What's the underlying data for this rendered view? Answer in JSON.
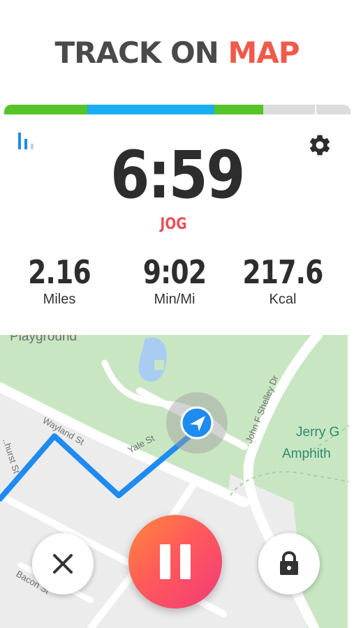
{
  "headline": {
    "part1": "TRACK ON",
    "part2": "MAP"
  },
  "colors": {
    "accent_red": "#f05a4a",
    "mode_red": "#e8505b",
    "route_blue": "#1e8bf0",
    "seg_green": "#55c428",
    "seg_blue": "#18aef0",
    "seg_gray": "#dcdcdc"
  },
  "progress_segments": [
    {
      "color": "#55c428",
      "fraction": 0.24
    },
    {
      "color": "#18aef0",
      "fraction": 0.37
    },
    {
      "color": "#55c428",
      "fraction": 0.14
    },
    {
      "color": "#dcdcdc",
      "fraction": 0.15
    },
    {
      "color": "#dcdcdc",
      "fraction": 0.1
    }
  ],
  "workout": {
    "timer": "6:59",
    "mode": "JOG",
    "stats": [
      {
        "value": "2.16",
        "unit": "Miles"
      },
      {
        "value": "9:02",
        "unit": "Min/Mi"
      },
      {
        "value": "217.6",
        "unit": "Kcal"
      }
    ]
  },
  "icons": {
    "stats": "bar-chart-icon",
    "settings": "gear-icon",
    "location": "navigation-arrow-icon",
    "close": "close-icon",
    "pause": "pause-icon",
    "lock": "lock-icon"
  },
  "map": {
    "labels": {
      "playground": "Playground",
      "wayland": "Wayland St",
      "yale": "Yale St",
      "bacon": "Bacon St",
      "shelley": "John F Shelley Dr",
      "amphi_line1": "Jerry G",
      "amphi_line2": "Amphith",
      "left_street": "..hurst St"
    }
  }
}
